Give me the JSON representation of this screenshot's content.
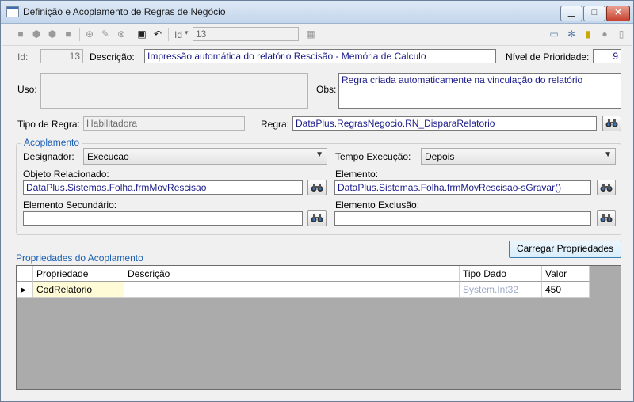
{
  "window": {
    "title": "Definição e Acoplamento de Regras de Negócio",
    "min_label": "▁",
    "max_label": "□",
    "close_label": "✕"
  },
  "toolbar": {
    "id_label": "Id",
    "id_value": "13"
  },
  "form": {
    "id_label": "Id:",
    "id_value": "13",
    "descricao_label": "Descrição:",
    "descricao_value": "Impressão automática do relatório Rescisão - Memória de Calculo",
    "prioridade_label": "Nível de Prioridade:",
    "prioridade_value": "9",
    "uso_label": "Uso:",
    "uso_value": "",
    "obs_label": "Obs:",
    "obs_value": "Regra criada automaticamente na vinculação do relatório",
    "tipo_label": "Tipo de Regra:",
    "tipo_value": "Habilitadora",
    "regra_label": "Regra:",
    "regra_value": "DataPlus.RegrasNegocio.RN_DisparaRelatorio"
  },
  "acoplamento": {
    "title": "Acoplamento",
    "designador_label": "Designador:",
    "designador_value": "Execucao",
    "tempo_label": "Tempo Execução:",
    "tempo_value": "Depois",
    "objeto_label": "Objeto Relacionado:",
    "objeto_value": "DataPlus.Sistemas.Folha.frmMovRescisao",
    "elemento_label": "Elemento:",
    "elemento_value": "DataPlus.Sistemas.Folha.frmMovRescisao-sGravar()",
    "secundario_label": "Elemento Secundário:",
    "secundario_value": "",
    "exclusao_label": "Elemento Exclusão:",
    "exclusao_value": ""
  },
  "propriedades": {
    "button_label": "Carregar Propriedades",
    "section_label": "Propriedades do Acoplamento",
    "columns": [
      "Propriedade",
      "Descrição",
      "Tipo Dado",
      "Valor"
    ],
    "rows": [
      {
        "indicator": "▶",
        "propriedade": "CodRelatorio",
        "descricao": "",
        "tipo": "System.Int32",
        "valor": "450"
      }
    ]
  },
  "colors": {
    "accent_blue": "#1a5fb4",
    "value_text": "#1a1a8a",
    "grid_bg": "#ababab",
    "selected_cell": "#fffbd6"
  }
}
